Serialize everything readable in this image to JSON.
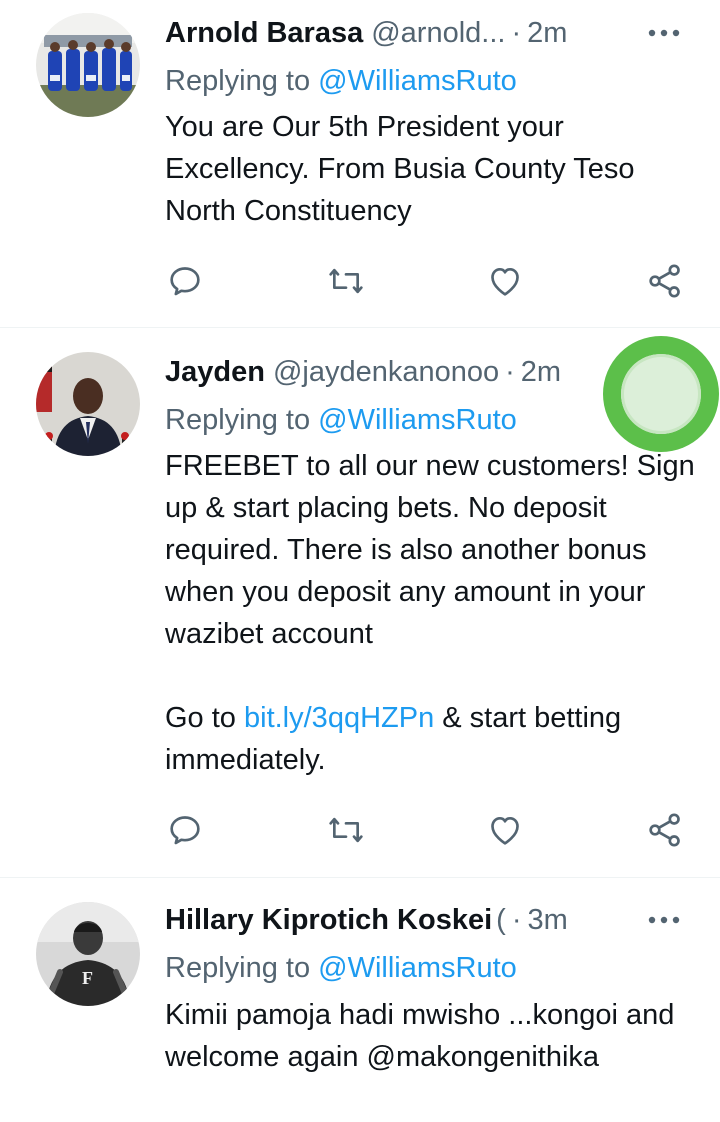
{
  "tweets": [
    {
      "name": "Arnold Barasa",
      "handle": "@arnold...",
      "separator": "·",
      "time": "2m",
      "replying_prefix": "Replying to ",
      "replying_to": "@WilliamsRuto",
      "text": "You are Our 5th President your Excellency. From Busia County Teso North Constituency"
    },
    {
      "name": "Jayden",
      "handle": "@jaydenkanonoo",
      "separator": "·",
      "time": "2m",
      "replying_prefix": "Replying to ",
      "replying_to": "@WilliamsRuto",
      "text_part1": "FREEBET to all our new customers! Sign up & start placing bets. No deposit required. There is also another bonus when you deposit any amount in your wazibet account",
      "text_go_prefix": "Go to ",
      "link": "bit.ly/3qqHZPn",
      "text_go_suffix": " & start betting immediately."
    },
    {
      "name": "Hillary Kiprotich Koskei",
      "handle": "(",
      "separator": "·",
      "time": "3m",
      "replying_prefix": "Replying to ",
      "replying_to": "@WilliamsRuto",
      "text": "Kimii pamoja hadi mwisho ...kongoi and welcome again @makongenithika"
    }
  ],
  "icons": {
    "reply": "reply-icon",
    "retweet": "retweet-icon",
    "like": "heart-icon",
    "share": "share-icon",
    "more": "more-icon"
  },
  "colors": {
    "link": "#1d9bf0",
    "secondary_text": "#536471",
    "primary_text": "#0f1419",
    "touch_indicator": "#5cbf4a"
  }
}
